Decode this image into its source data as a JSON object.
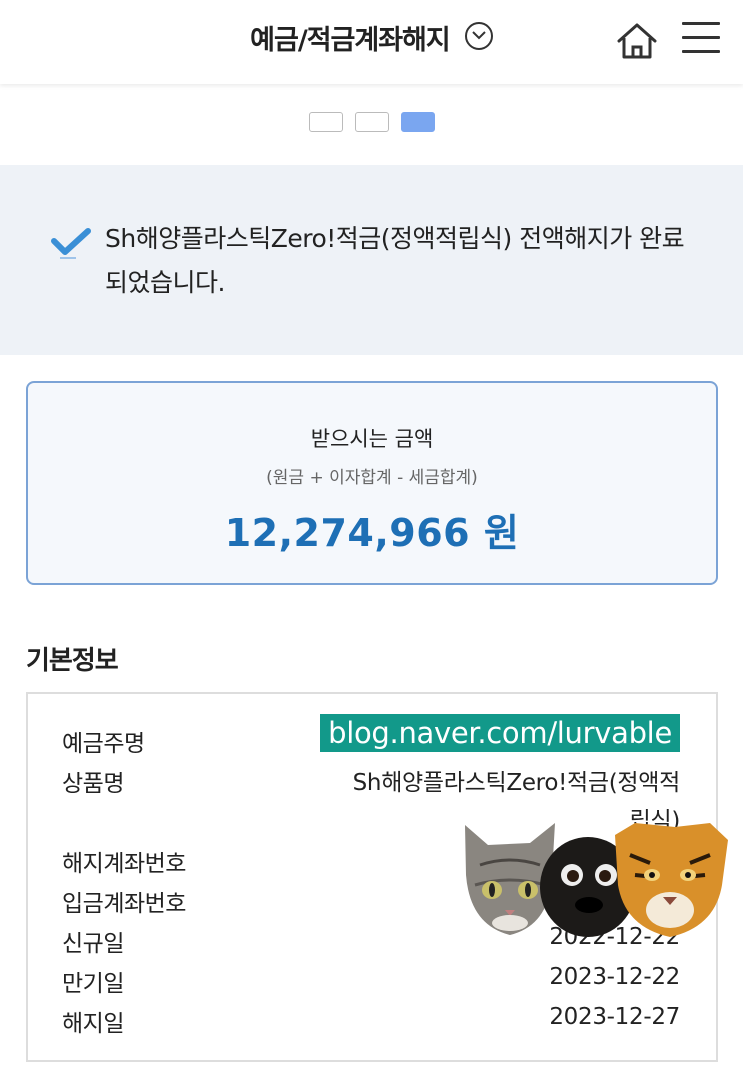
{
  "header": {
    "title": "예금/적금계좌해지"
  },
  "steps": {
    "total": 3,
    "active_index": 3
  },
  "notice": {
    "message": "Sh해양플라스틱Zero!적금(정액적립식) 전액해지가 완료되었습니다."
  },
  "amount": {
    "label": "받으시는 금액",
    "sublabel": "(원금 + 이자합계 - 세금합계)",
    "value": "12,274,966 원"
  },
  "basic_info": {
    "title": "기본정보",
    "rows": [
      {
        "label": "예금주명",
        "value": "blog.naver.com/lurvable"
      },
      {
        "label": "상품명",
        "value": "Sh해양플라스틱Zero!적금(정액적립식)"
      },
      {
        "label": "해지계좌번호",
        "value": ""
      },
      {
        "label": "입금계좌번호",
        "value": ""
      },
      {
        "label": "신규일",
        "value": "2022-12-22"
      },
      {
        "label": "만기일",
        "value": "2023-12-22"
      },
      {
        "label": "해지일",
        "value": "2023-12-27"
      }
    ]
  },
  "colors": {
    "accent": "#1e6fb5",
    "step_active": "#7aa6f0",
    "check": "#3a8fd6",
    "watermark_bg": "#12998a"
  },
  "icons": [
    "chevron-down-icon",
    "home-icon",
    "menu-icon",
    "check-icon"
  ]
}
